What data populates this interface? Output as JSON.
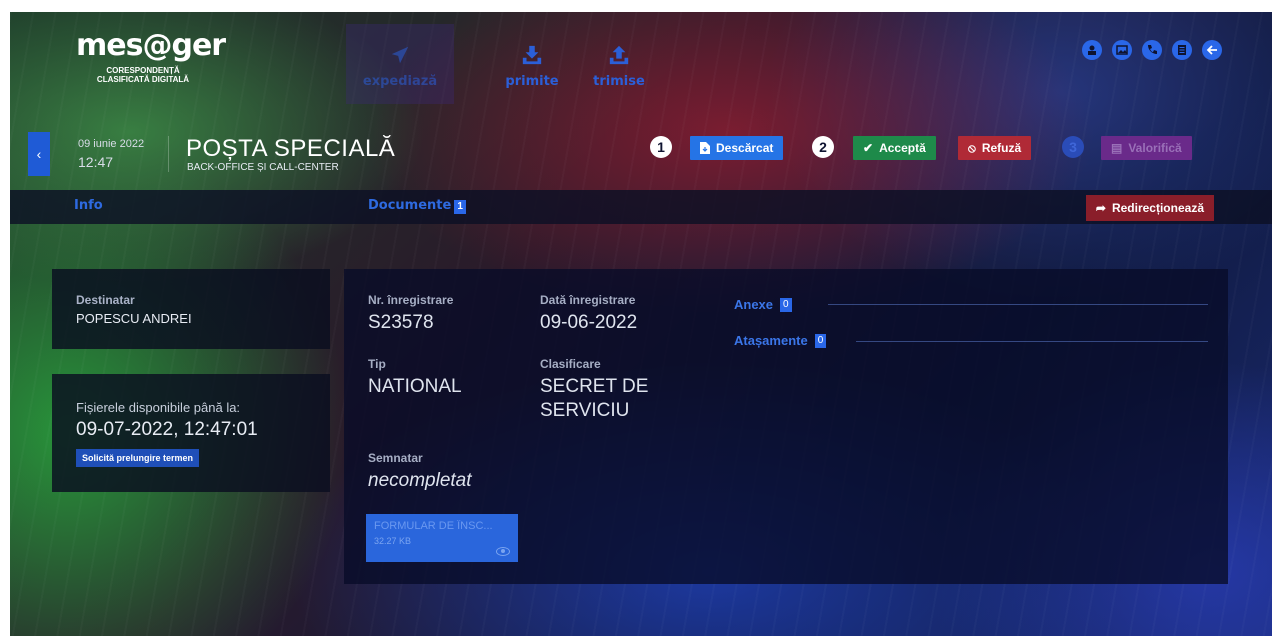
{
  "header": {
    "logo_text": "mes@ger",
    "logo_subtitle_line1": "CORESPONDENȚĂ",
    "logo_subtitle_line2": "CLASIFICATĂ DIGITALĂ",
    "nav": [
      {
        "label": "expediază",
        "icon": "send-icon",
        "active": true
      },
      {
        "label": "primite",
        "icon": "download-tray-icon",
        "active": false
      },
      {
        "label": "trimise",
        "icon": "upload-tray-icon",
        "active": false
      }
    ],
    "top_icons": [
      "agent-icon",
      "image-icon",
      "phone-icon",
      "document-icon",
      "arrow-left-icon"
    ]
  },
  "title_row": {
    "date": "09 iunie 2022",
    "time": "12:47",
    "org_title": "POȘTA SPECIALĂ",
    "org_subtitle": "BACK-OFFICE ȘI CALL-CENTER",
    "steps": [
      "1",
      "2",
      "3"
    ],
    "download_label": "Descărcat",
    "accept_label": "Acceptă",
    "refuse_label": "Refuză",
    "validate_label": "Valorifică"
  },
  "tabs": {
    "info_label": "Info",
    "documents_label": "Documente",
    "documents_count": "1",
    "redirect_label": "Redirecționează"
  },
  "recipient": {
    "label": "Destinatar",
    "value": "POPESCU ANDREI"
  },
  "availability": {
    "label": "Fișierele disponibile până la:",
    "value": "09-07-2022, 12:47:01",
    "extend_button": "Solicită prelungire termen"
  },
  "document": {
    "reg_no_label": "Nr. înregistrare",
    "reg_no": "S23578",
    "reg_date_label": "Dată înregistrare",
    "reg_date": "09-06-2022",
    "type_label": "Tip",
    "type": "NATIONAL",
    "classification_label": "Clasificare",
    "classification_line1": "SECRET DE",
    "classification_line2": "SERVICIU",
    "signed_label": "Semnatar",
    "signed_value": "necompletat",
    "annexes_label": "Anexe",
    "annexes_count": "0",
    "attachments_label": "Atașamente",
    "attachments_count": "0",
    "file": {
      "name": "FORMULAR DE ÎNSC...",
      "size": "32.27 KB"
    }
  },
  "colors": {
    "accent_blue": "#2574e6",
    "accept_green": "#1e8a4a",
    "refuse_red": "#b02a36",
    "redirect_red": "#8a1e2a"
  }
}
